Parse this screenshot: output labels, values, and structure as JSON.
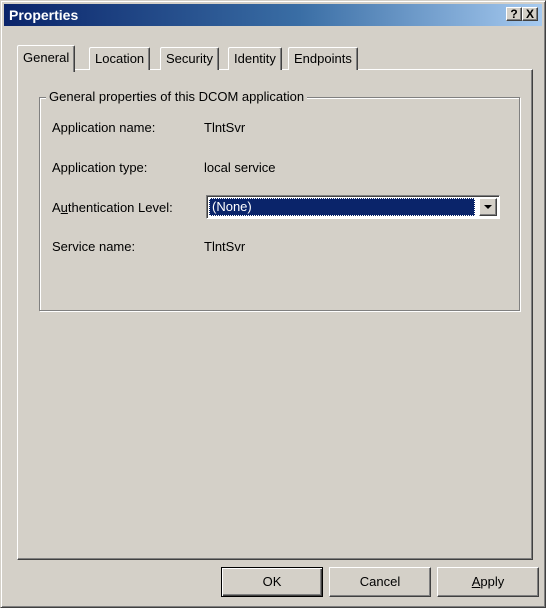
{
  "window": {
    "title": "Properties",
    "help_label": "?",
    "close_label": "X"
  },
  "tabs": [
    {
      "label": "General",
      "active": true
    },
    {
      "label": "Location",
      "active": false
    },
    {
      "label": "Security",
      "active": false
    },
    {
      "label": "Identity",
      "active": false
    },
    {
      "label": "Endpoints",
      "active": false
    }
  ],
  "general": {
    "group_title": "General properties of this DCOM application",
    "app_name_label": "Application name:",
    "app_name_value": "TlntSvr",
    "app_type_label": "Application type:",
    "app_type_value": "local service",
    "auth_label_pre": "A",
    "auth_label_accel": "u",
    "auth_label_post": "thentication Level:",
    "auth_value": "(None)",
    "service_label": "Service name:",
    "service_value": "TlntSvr"
  },
  "buttons": {
    "ok": "OK",
    "cancel": "Cancel",
    "apply_accel": "A",
    "apply_rest": "pply"
  },
  "colors": {
    "face": "#d4d0c8",
    "title_start": "#0a246a",
    "title_end": "#a6caf0",
    "selection": "#0a246a"
  }
}
